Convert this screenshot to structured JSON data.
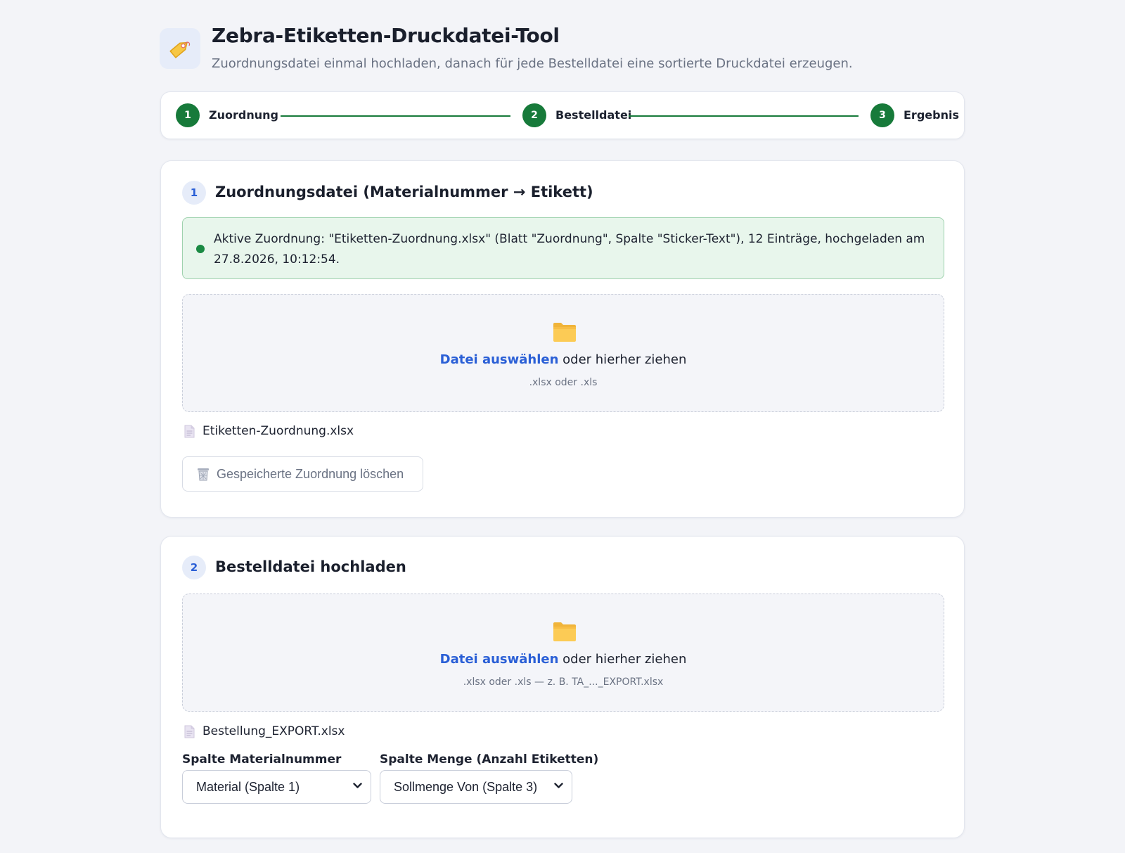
{
  "header": {
    "app_icon": "price-tag-icon",
    "title": "Zebra-Etiketten-Druckdatei-Tool",
    "subtitle": "Zuordnungsdatei einmal hochladen, danach für jede Bestelldatei eine sortierte Druckdatei erzeugen."
  },
  "stepper": {
    "steps": [
      {
        "number": "1",
        "label": "Zuordnung"
      },
      {
        "number": "2",
        "label": "Bestelldatei"
      },
      {
        "number": "3",
        "label": "Ergebnis"
      }
    ],
    "accent_color": "#177a3a"
  },
  "section_mapping": {
    "number": "1",
    "title": "Zuordnungsdatei (Materialnummer → Etikett)",
    "status_text": "Aktive Zuordnung: \"Etiketten-Zuordnung.xlsx\" (Blatt \"Zuordnung\", Spalte \"Sticker-Text\"), 12 Einträge, hochgeladen am 27.8.2026, 10:12:54.",
    "dropzone": {
      "icon": "folder-icon",
      "link_label": "Datei auswählen",
      "text": " oder hierher ziehen",
      "hint": ".xlsx oder .xls"
    },
    "file": {
      "icon": "file-icon",
      "name": "Etiketten-Zuordnung.xlsx"
    },
    "delete_button": {
      "icon": "trash-icon",
      "label": "Gespeicherte Zuordnung löschen"
    }
  },
  "section_order": {
    "number": "2",
    "title": "Bestelldatei hochladen",
    "dropzone": {
      "icon": "folder-icon",
      "link_label": "Datei auswählen",
      "text": " oder hierher ziehen",
      "hint": ".xlsx oder .xls — z. B. TA_..._EXPORT.xlsx"
    },
    "file": {
      "icon": "file-icon",
      "name": "Bestellung_EXPORT.xlsx"
    },
    "material_column": {
      "label": "Spalte Materialnummer",
      "selected": "Material (Spalte 1)"
    },
    "quantity_column": {
      "label": "Spalte Menge (Anzahl Etiketten)",
      "selected": "Sollmenge Von (Spalte 3)"
    }
  },
  "colors": {
    "link": "#2a5fd6",
    "success_bg": "#e8f6ec",
    "success_border": "#9fd2ae"
  }
}
